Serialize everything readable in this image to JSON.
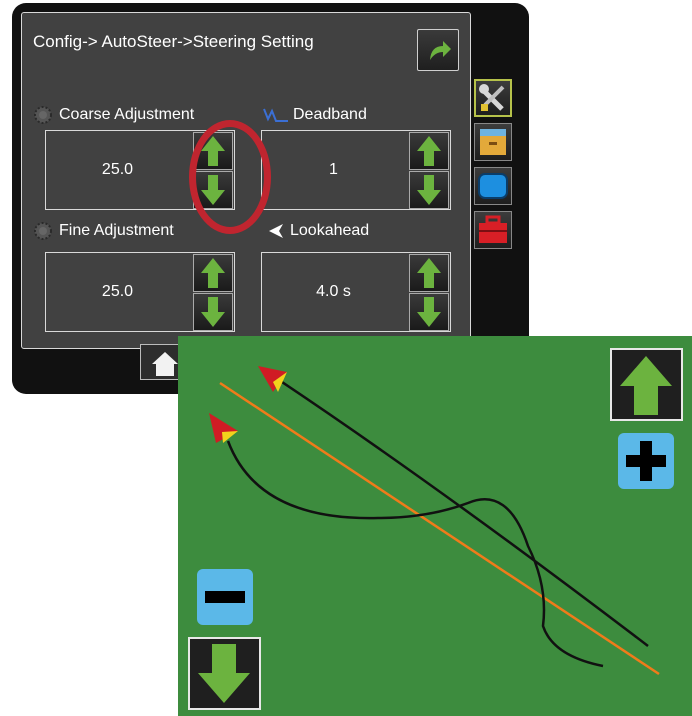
{
  "header": {
    "breadcrumb": "Config-> AutoSteer->Steering Setting"
  },
  "settings": {
    "coarse": {
      "label": "Coarse Adjustment",
      "value": "25.0"
    },
    "deadband": {
      "label": "Deadband",
      "value": "1"
    },
    "fine": {
      "label": "Fine Adjustment",
      "value": "25.0"
    },
    "lookahead": {
      "label": "Lookahead",
      "value": "4.0 s"
    }
  },
  "sidebar": {
    "items": [
      {
        "name": "tools",
        "icon": "wrench-screwdriver-icon",
        "active": true
      },
      {
        "name": "data",
        "icon": "file-cabinet-icon",
        "active": false
      },
      {
        "name": "display",
        "icon": "display-icon",
        "active": false
      },
      {
        "name": "toolbox",
        "icon": "toolbox-icon",
        "active": false
      }
    ]
  },
  "map": {
    "zoom_in_icon": "arrow-up-icon",
    "zoom_out_icon": "arrow-down-icon",
    "plus_icon": "plus-icon",
    "minus_icon": "minus-icon"
  },
  "colors": {
    "arrow_green": "#6cb33f",
    "highlight_red": "#c0252f",
    "field_green": "#3d8c3e",
    "guide_orange": "#f07b1a",
    "zoom_blue": "#5bb8e8"
  }
}
